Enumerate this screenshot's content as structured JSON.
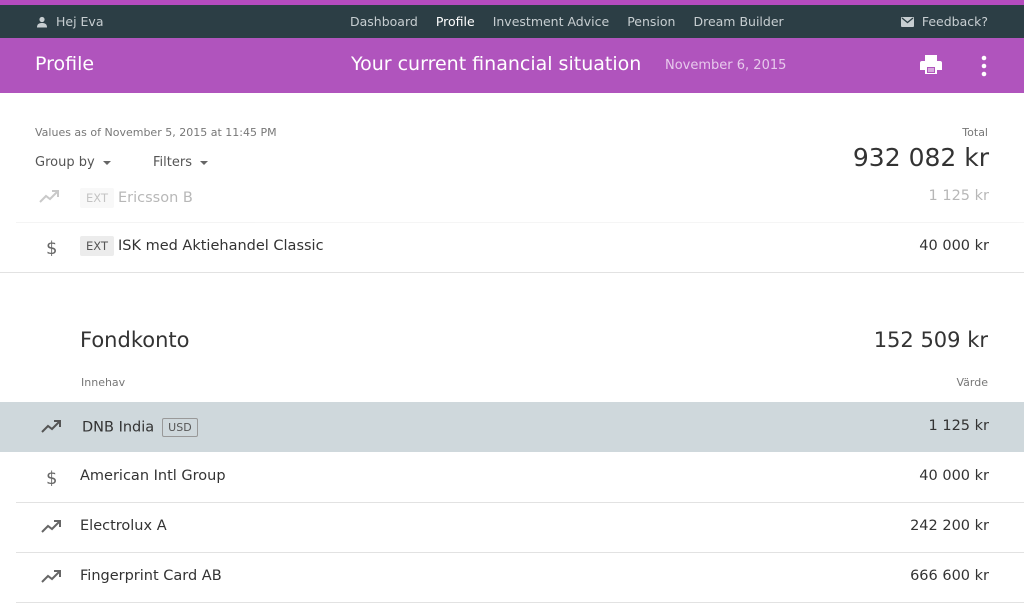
{
  "topbar": {
    "greeting": "Hej Eva",
    "nav": [
      "Dashboard",
      "Profile",
      "Investment Advice",
      "Pension",
      "Dream Builder"
    ],
    "active_nav": "Profile",
    "feedback": "Feedback?"
  },
  "header": {
    "page_name": "Profile",
    "title": "Your current financial situation",
    "date": "November 6, 2015"
  },
  "summary": {
    "as_of": "Values as of November 5, 2015 at 11:45 PM",
    "group_by": "Group by",
    "filters": "Filters",
    "total_label": "Total",
    "total_value": "932 082 kr"
  },
  "prev_account": {
    "rows": [
      {
        "icon": "trend-up-icon",
        "tag": "EXT",
        "name": "Ericsson B",
        "value": "1 125 kr"
      },
      {
        "icon": "dollar-icon",
        "tag": "EXT",
        "name": "ISK med Aktiehandel Classic",
        "value": "40 000 kr"
      }
    ]
  },
  "fondkonto": {
    "title": "Fondkonto",
    "value": "152 509 kr",
    "col_holdings": "Innehav",
    "col_value": "Värde",
    "rows": [
      {
        "icon": "trend-up-icon",
        "name": "DNB India",
        "currency": "USD",
        "value": "1 125 kr"
      },
      {
        "icon": "dollar-icon",
        "name": "American Intl Group",
        "value": "40 000 kr"
      },
      {
        "icon": "trend-up-icon",
        "name": "Electrolux A",
        "value": "242 200 kr"
      },
      {
        "icon": "trend-up-icon",
        "name": "Fingerprint Card AB",
        "value": "666 600 kr"
      }
    ]
  },
  "colors": {
    "accent": "#b054bd",
    "topbar": "#2c3e45",
    "highlight_row": "#cfd8dc"
  }
}
